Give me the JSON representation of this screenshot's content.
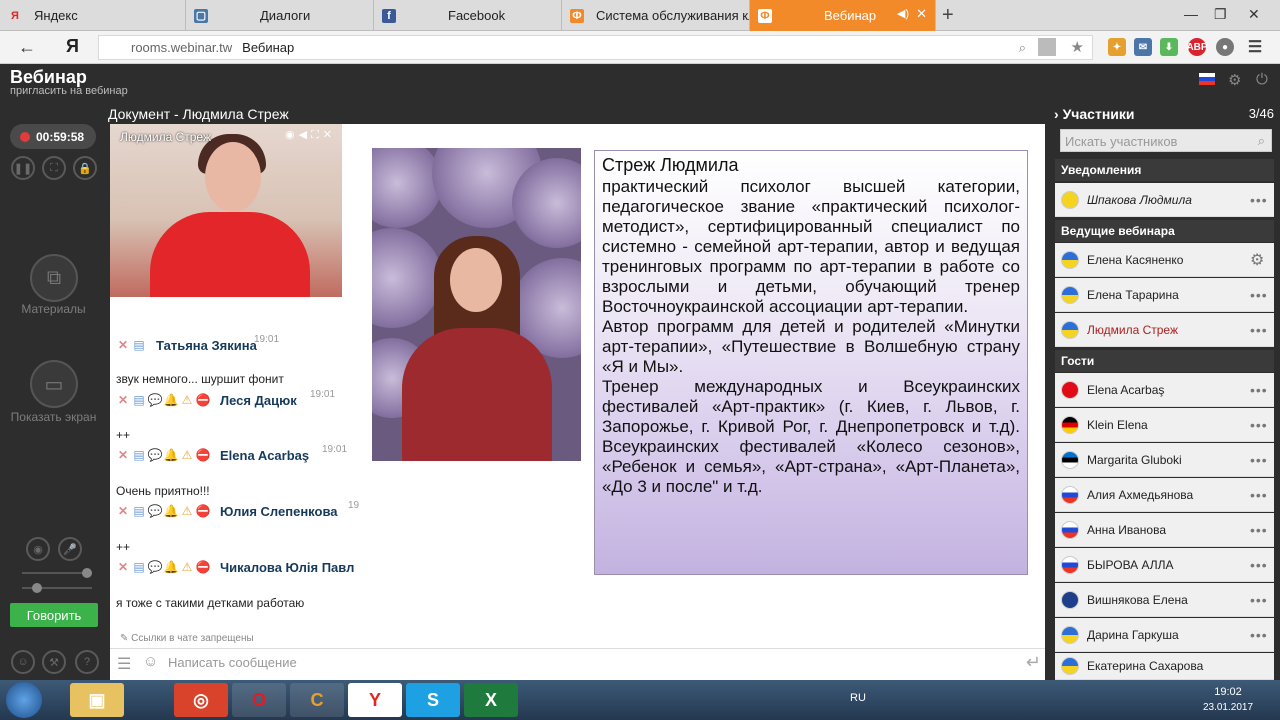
{
  "browser": {
    "tabs": [
      {
        "label": "Яндекс",
        "fav": "Я",
        "color": "#e52620"
      },
      {
        "label": "Диалоги",
        "fav": "▢",
        "color": "#4a76a8"
      },
      {
        "label": "Facebook",
        "fav": "f",
        "color": "#3b5998"
      },
      {
        "label": "Система обслуживания кли",
        "fav": "Ф",
        "color": "#f28a2a"
      },
      {
        "label": "Вебинар",
        "fav": "Ф",
        "color": "#ffffff"
      }
    ],
    "address": {
      "domain": "rooms.webinar.tw",
      "page": "Вебинар"
    },
    "yandex_logo": "Я"
  },
  "app": {
    "title": "Вебинар",
    "subtitle": "пригласить на вебинар",
    "timer": "00:59:58",
    "rail": {
      "materials": "Материалы",
      "show_screen": "Показать экран",
      "speak": "Говорить"
    },
    "document_title": "Документ - Людмила Стреж",
    "video_name": "Людмила Стреж"
  },
  "bio": {
    "name": "Стреж Людмила",
    "text": " практический психолог высшей категории, педагогическое звание «практический психолог-методист», сертифицированный специалист по системно - семейной арт-терапии, автор и ведущая тренинговых программ по арт-терапии в работе со взрослыми и детьми, обучающий тренер Восточноукраинской ассоциации арт-терапии.",
    "text2": "Автор программ для детей и родителей «Минутки арт-терапии», «Путешествие в Волшебную страну «Я и Мы».",
    "text3": "Тренер международных и Всеукраинских фестивалей «Арт-практик» (г. Киев, г. Львов, г. Запорожье, г. Кривой Рог, г. Днепропетровск и т.д). Всеукраинских фестивалей «Колесо сезонов», «Ребенок и семья», «Арт-страна», «Арт-Планета», «До 3 и после\" и т.д."
  },
  "chat": {
    "messages": [
      {
        "author": "Татьяна Зякина",
        "time": "19:01",
        "text": "звук немного... шуршит фонит"
      },
      {
        "author": "Леся Дацюк",
        "time": "19:01",
        "text": "++"
      },
      {
        "author": "Elena Acarbaş",
        "time": "19:01",
        "text": "Очень  приятно!!!"
      },
      {
        "author": "Юлия Слепенкова",
        "time": "19",
        "text": "++"
      },
      {
        "author": "Чикалова Юлія Павл",
        "time": "",
        "text": "я тоже с такими детками работаю"
      }
    ],
    "links_note": "Ссылки в чате запрещены",
    "input_placeholder": "Написать сообщение"
  },
  "participants": {
    "title": "Участники",
    "count": "3/46",
    "search_placeholder": "Искать участников",
    "sections": {
      "notifications": "Уведомления",
      "hosts": "Ведущие вебинара",
      "guests": "Гости"
    },
    "notifications": [
      {
        "name": "Шпакова Людмила",
        "flag": "mail"
      }
    ],
    "hosts": [
      {
        "name": "Елена Касяненко",
        "flag": "ua"
      },
      {
        "name": "Елена Тарарина",
        "flag": "ua"
      },
      {
        "name": "Людмила Стреж",
        "flag": "ua"
      }
    ],
    "guests": [
      {
        "name": "Elena Acarbaş",
        "flag": "tr"
      },
      {
        "name": "Klein Elena",
        "flag": "de"
      },
      {
        "name": "Margarita Gluboki",
        "flag": "ee"
      },
      {
        "name": "Алия Ахмедьянова",
        "flag": "ru"
      },
      {
        "name": "Анна Иванова",
        "flag": "ru"
      },
      {
        "name": "БЫРОВА АЛЛА",
        "flag": "ru"
      },
      {
        "name": "Вишнякова Елена",
        "flag": "gb"
      },
      {
        "name": "Дарина Гаркуша",
        "flag": "ua"
      },
      {
        "name": "Екатерина Сахарова",
        "flag": "ua"
      }
    ]
  },
  "taskbar": {
    "lang": "RU",
    "time": "19:02",
    "date": "23.01.2017"
  }
}
